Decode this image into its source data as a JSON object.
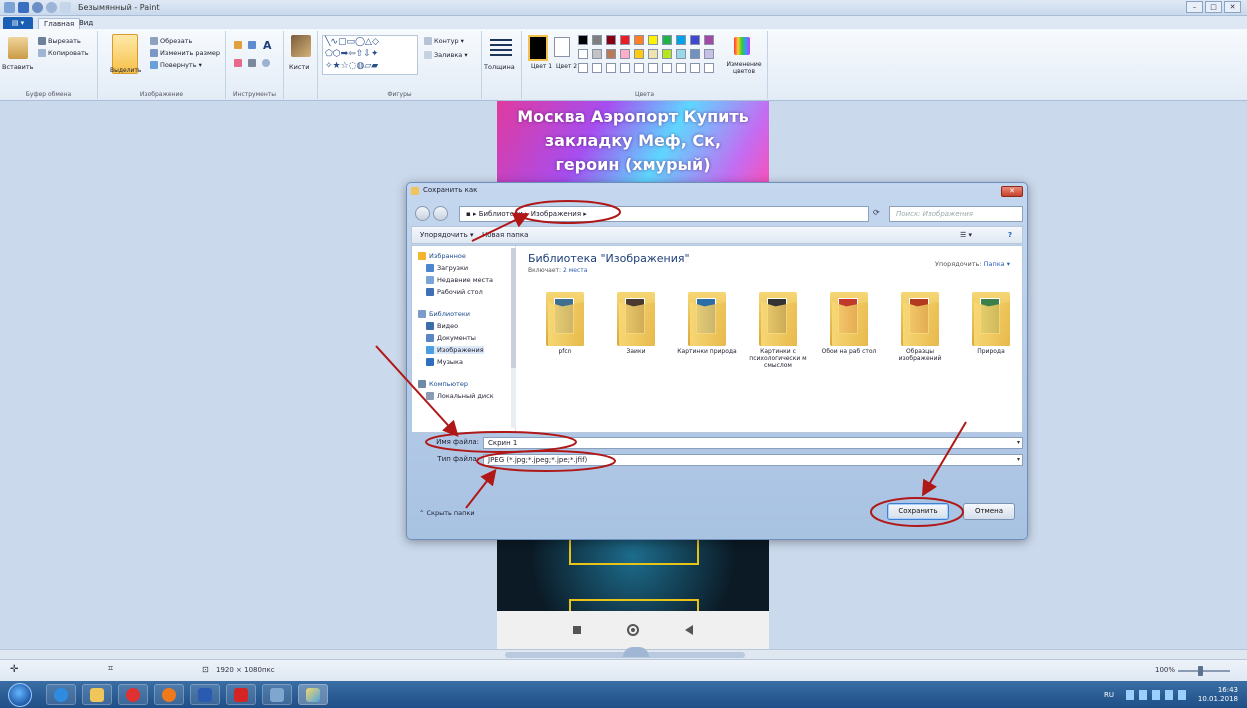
{
  "app": {
    "title": "Безымянный - Paint",
    "tabs": [
      "Главная",
      "Вид"
    ],
    "file_tab": "▤ ▾",
    "win_buttons": [
      "–",
      "□",
      "✕"
    ]
  },
  "ribbon": {
    "clipboard": {
      "paste": "Вставить",
      "cut": "Вырезать",
      "copy": "Копировать",
      "group": "Буфер обмена"
    },
    "image": {
      "select": "Выделить",
      "crop": "Обрезать",
      "resize": "Изменить размер",
      "rotate": "Повернуть ▾",
      "group": "Изображение"
    },
    "tools": {
      "group": "Инструменты"
    },
    "brushes": {
      "label": "Кисти"
    },
    "shapes": {
      "outline": "Контур ▾",
      "fill": "Заливка ▾",
      "group": "Фигуры"
    },
    "size": {
      "label": "Толщина"
    },
    "colors": {
      "color1": "Цвет 1",
      "color2": "Цвет 2",
      "edit": "Изменение цветов",
      "group": "Цвета",
      "palette": [
        "#000000",
        "#7f7f7f",
        "#880015",
        "#ed1c24",
        "#ff7f27",
        "#fff200",
        "#22b14c",
        "#00a2e8",
        "#3f48cc",
        "#a349a4",
        "#ffffff",
        "#c3c3c3",
        "#b97a57",
        "#ffaec9",
        "#ffc90e",
        "#efe4b0",
        "#b5e61d",
        "#99d9ea",
        "#7092be",
        "#c8bfe7"
      ]
    }
  },
  "canvas": {
    "banner_lines": [
      "Москва Аэропорт Купить",
      "закладку Меф, Ск,",
      "героин (хмурый)"
    ]
  },
  "statusbar": {
    "dimensions": "1920 × 1080пкс",
    "zoom": "100%",
    "icons": [
      "✛",
      "⌗",
      "⊡"
    ]
  },
  "taskbar": {
    "lang": "RU",
    "time": "16:43",
    "date": "10.01.2018"
  },
  "dialog": {
    "title": "Сохранить как",
    "close": "✕",
    "address": "▪ ▸ Библиотеки ▸ Изображения ▸",
    "search_placeholder": "Поиск: Изображения",
    "organize": "Упорядочить ▾",
    "new_folder": "Новая папка",
    "view_icons": "☰ ▾",
    "help": "?",
    "tree": [
      {
        "label": "Избранное",
        "head": true
      },
      {
        "label": "Загрузки"
      },
      {
        "label": "Недавние места"
      },
      {
        "label": "Рабочий стол"
      },
      {
        "label": "Библиотеки",
        "head": true
      },
      {
        "label": "Видео"
      },
      {
        "label": "Документы"
      },
      {
        "label": "Изображения",
        "selected": true
      },
      {
        "label": "Музыка"
      },
      {
        "label": "Компьютер",
        "head": true
      },
      {
        "label": "Локальный диск"
      }
    ],
    "library_title": "Библиотека \"Изображения\"",
    "library_sub_prefix": "Включает:",
    "library_sub_link": "2 места",
    "arrange_prefix": "Упорядочить:",
    "arrange_value": "Папка ▾",
    "folders": [
      {
        "name": "pfcn",
        "pic": "#3f6f8e"
      },
      {
        "name": "Заики",
        "pic": "#4c3a2f"
      },
      {
        "name": "Картинки природа",
        "pic": "#2b6ea6"
      },
      {
        "name": "Картинки с психологически м смыслом",
        "pic": "#333333"
      },
      {
        "name": "Обои на раб стол",
        "pic": "#c0392b"
      },
      {
        "name": "Образцы изображений",
        "pic": "#b33a1e"
      },
      {
        "name": "Природа",
        "pic": "#3d7f4a"
      }
    ],
    "filename_label": "Имя файла:",
    "filename_value": "Скрин 1",
    "filetype_label": "Тип файла:",
    "filetype_value": "JPEG (*.jpg;*.jpeg;*.jpe;*.jfif)",
    "dropdown_glyph": "▾",
    "hide_folders": "⌃ Скрыть папки",
    "save": "Сохранить",
    "cancel": "Отмена"
  },
  "annotation_color": "#b01818"
}
